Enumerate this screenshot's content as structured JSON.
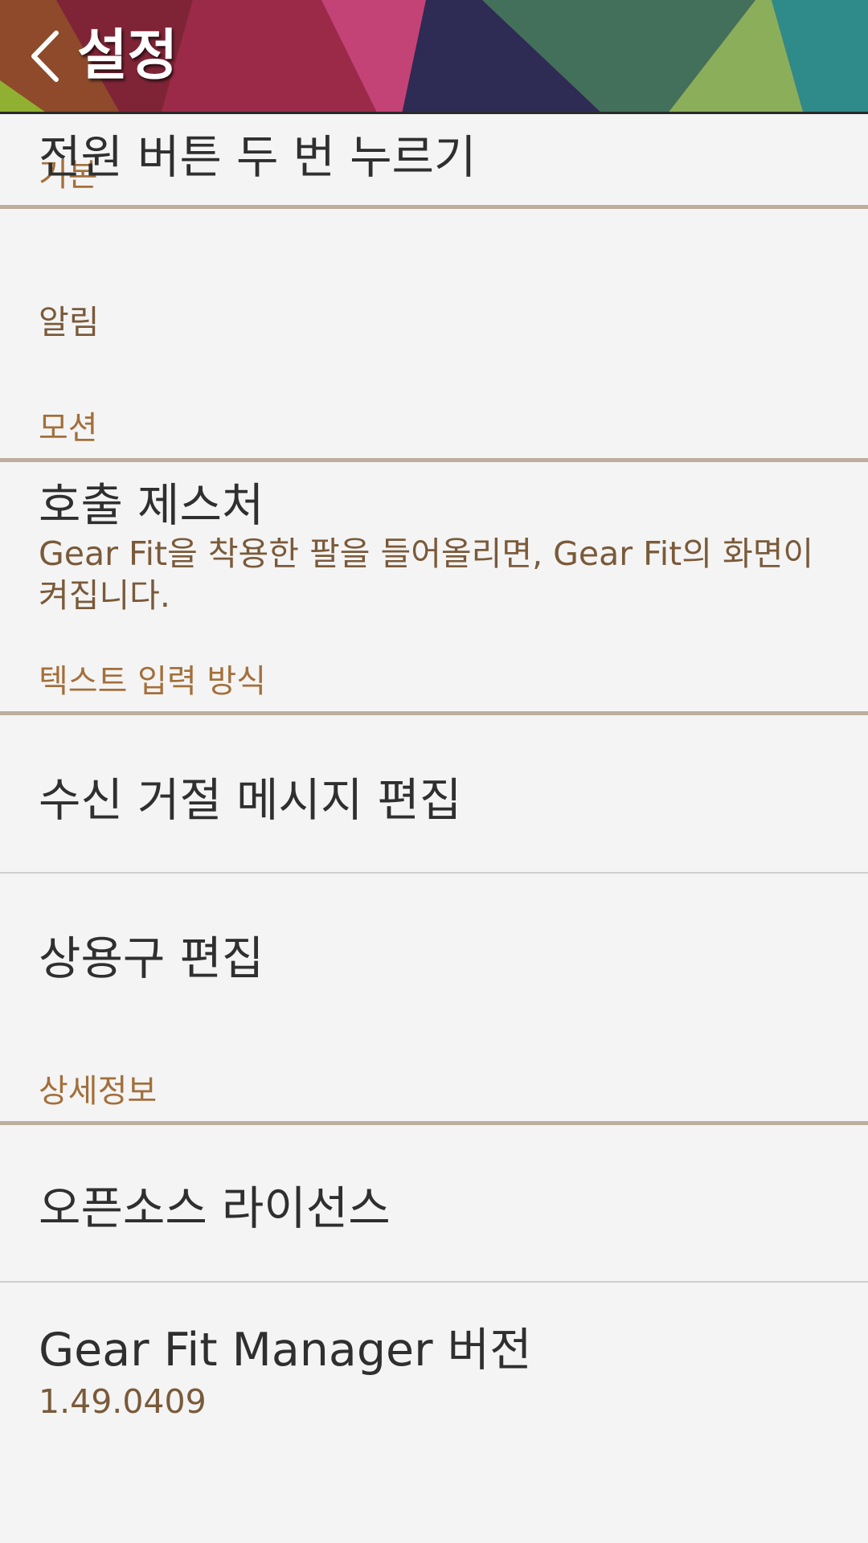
{
  "header": {
    "title": "설정",
    "back_icon": "chevron-left-icon"
  },
  "sections": {
    "basic": {
      "label": "기본",
      "items": {
        "double_press": {
          "title": "전원 버튼 두 번 누르기",
          "subtitle": "알림"
        }
      }
    },
    "motion": {
      "label": "모션",
      "items": {
        "wake_gesture": {
          "title": "호출 제스처",
          "subtitle": "Gear Fit을 착용한 팔을 들어올리면, Gear Fit의 화면이 켜집니다."
        }
      }
    },
    "text_input": {
      "label": "텍스트 입력 방식",
      "items": {
        "reject_messages": {
          "title": "수신 거절 메시지 편집"
        },
        "quick_phrases": {
          "title": "상용구 편집"
        }
      }
    },
    "about": {
      "label": "상세정보",
      "items": {
        "open_source": {
          "title": "오픈소스 라이선스"
        },
        "version": {
          "title": "Gear Fit Manager 버전",
          "subtitle": "1.49.0409"
        }
      }
    }
  },
  "colors": {
    "background": "#f4f4f4",
    "section_label": "#a36f3b",
    "section_rule": "#bdae9d",
    "title_text": "#2f2f2f",
    "subtitle_text": "#7a5a3a"
  }
}
